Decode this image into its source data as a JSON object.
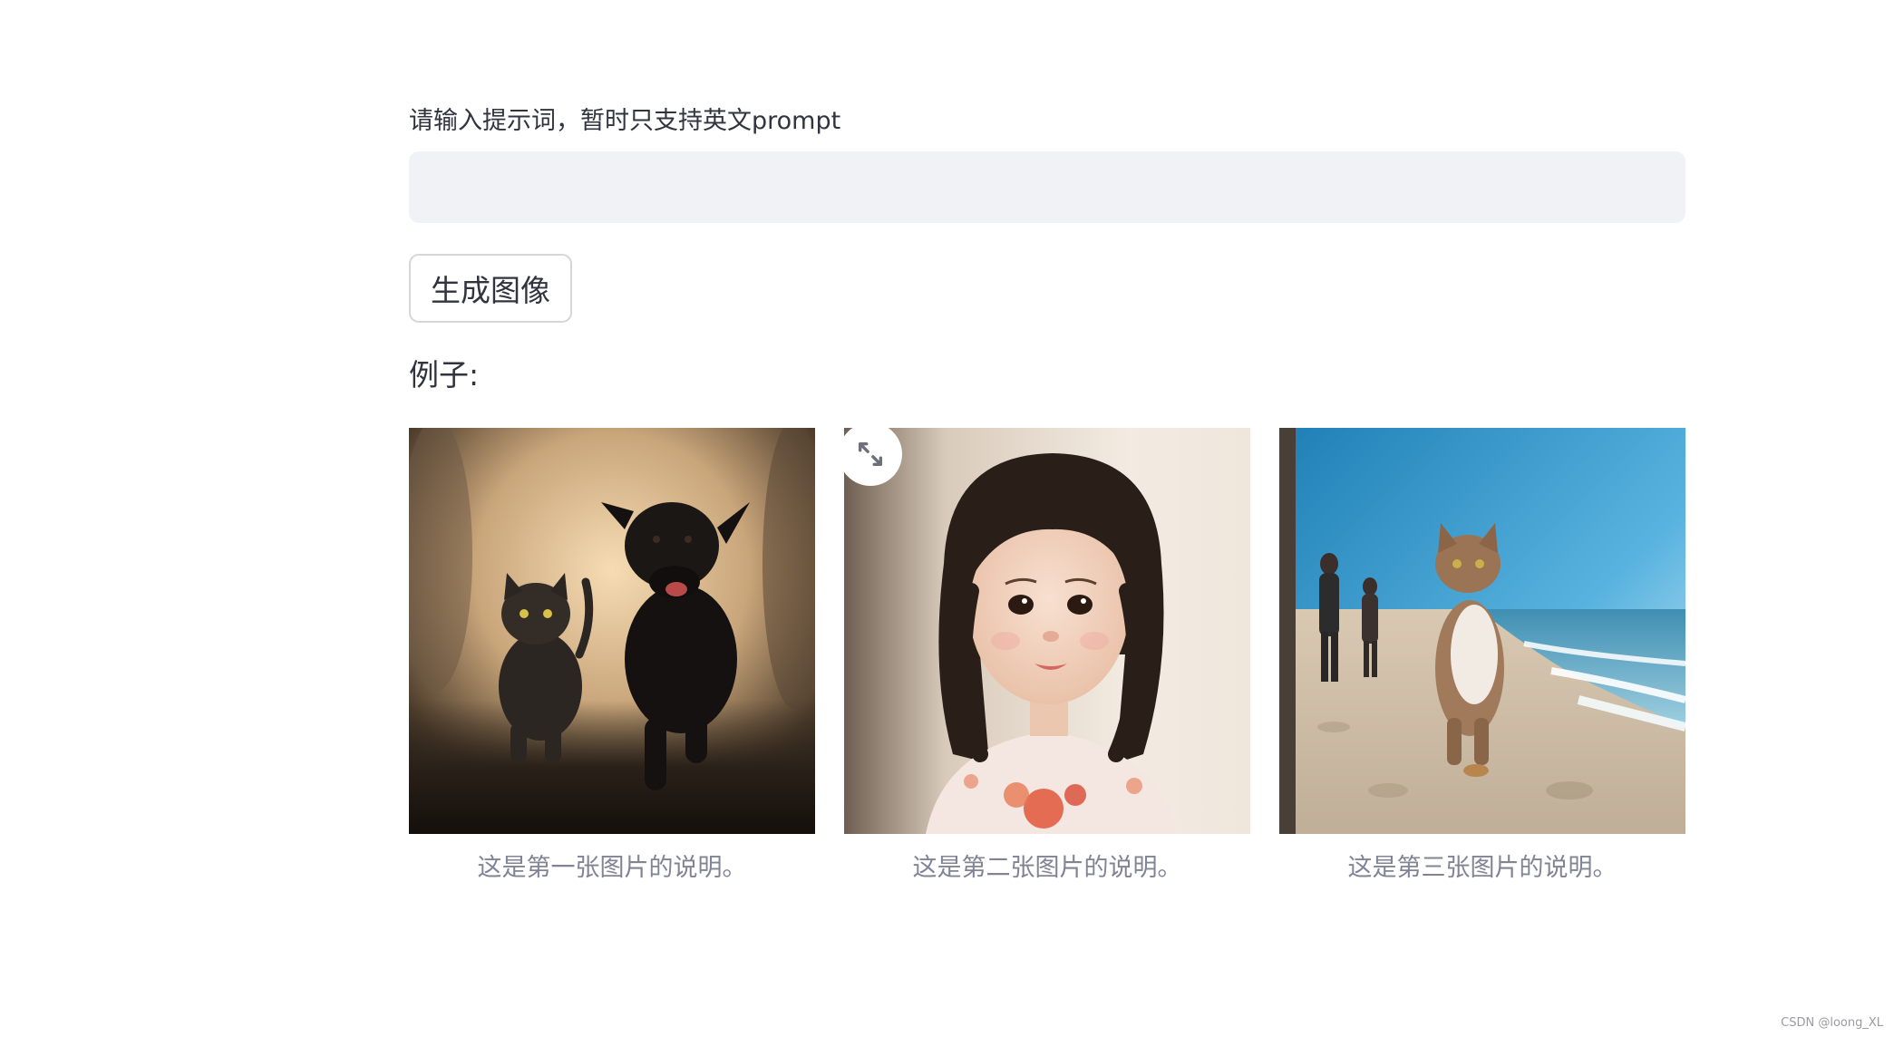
{
  "prompt": {
    "label": "请输入提示词，暂时只支持英文prompt",
    "value": "",
    "placeholder": ""
  },
  "generate_button": {
    "label": "生成图像"
  },
  "examples": {
    "title": "例子:",
    "items": [
      {
        "image": "cat-and-dog-running",
        "caption": "这是第一张图片的说明。"
      },
      {
        "image": "little-girl-portrait",
        "caption": "这是第二张图片的说明。"
      },
      {
        "image": "cat-on-beach",
        "caption": "这是第三张图片的说明。"
      }
    ],
    "fullscreen_icon": "expand-icon"
  },
  "watermark": "CSDN @loong_XL"
}
